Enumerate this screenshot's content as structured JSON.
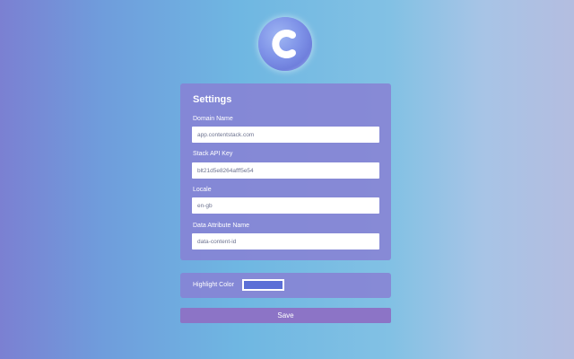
{
  "logo": {
    "icon": "contentstack-c-icon",
    "letter": "C"
  },
  "settings": {
    "title": "Settings",
    "fields": [
      {
        "label": "Domain Name",
        "value": "app.contentstack.com"
      },
      {
        "label": "Stack API Key",
        "value": "blt21d5e8264afff5e54"
      },
      {
        "label": "Locale",
        "value": "en-gb"
      },
      {
        "label": "Data Attribute Name",
        "value": "data-content-id"
      }
    ]
  },
  "highlight": {
    "label": "Highlight Color",
    "color": "#5b6fd6"
  },
  "save_label": "Save"
}
